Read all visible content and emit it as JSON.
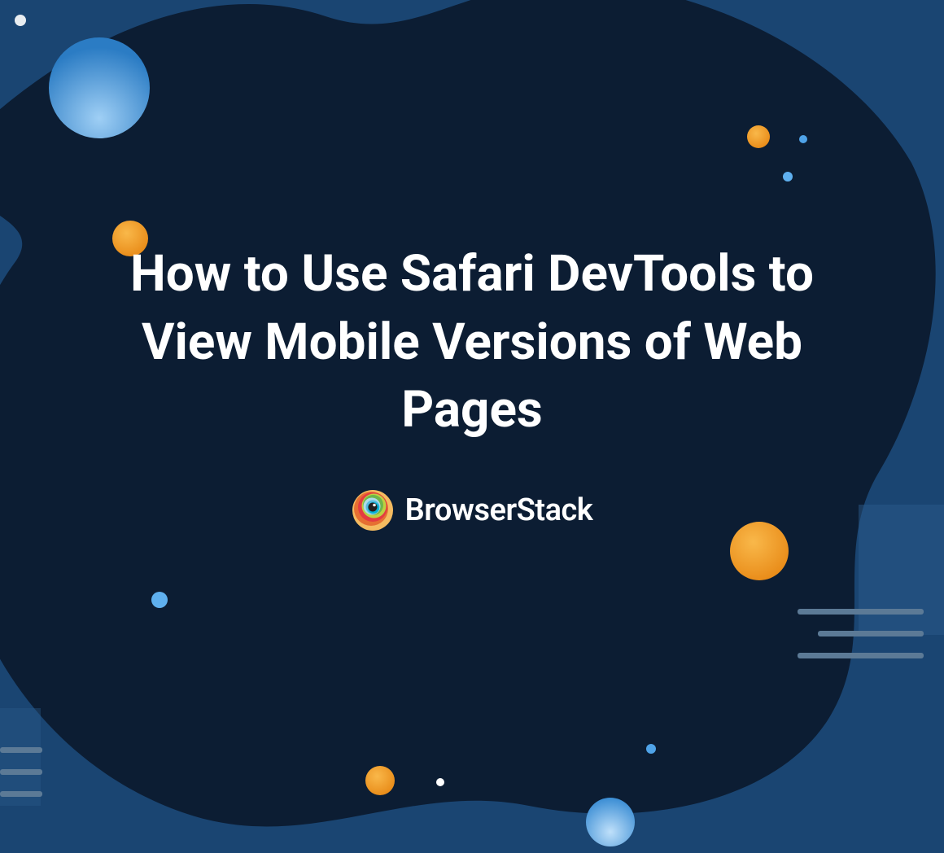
{
  "headline": "How to Use Safari DevTools to View Mobile Versions of Web Pages",
  "brand": {
    "name": "BrowserStack"
  },
  "colors": {
    "bg_dark": "#0c1d33",
    "bg_mid": "#183a62",
    "bg_light": "#1d4a7a",
    "orange": "#f59e0b",
    "blue_light": "#4fa3e8",
    "white": "#ffffff",
    "gray_line": "#5c7288"
  }
}
